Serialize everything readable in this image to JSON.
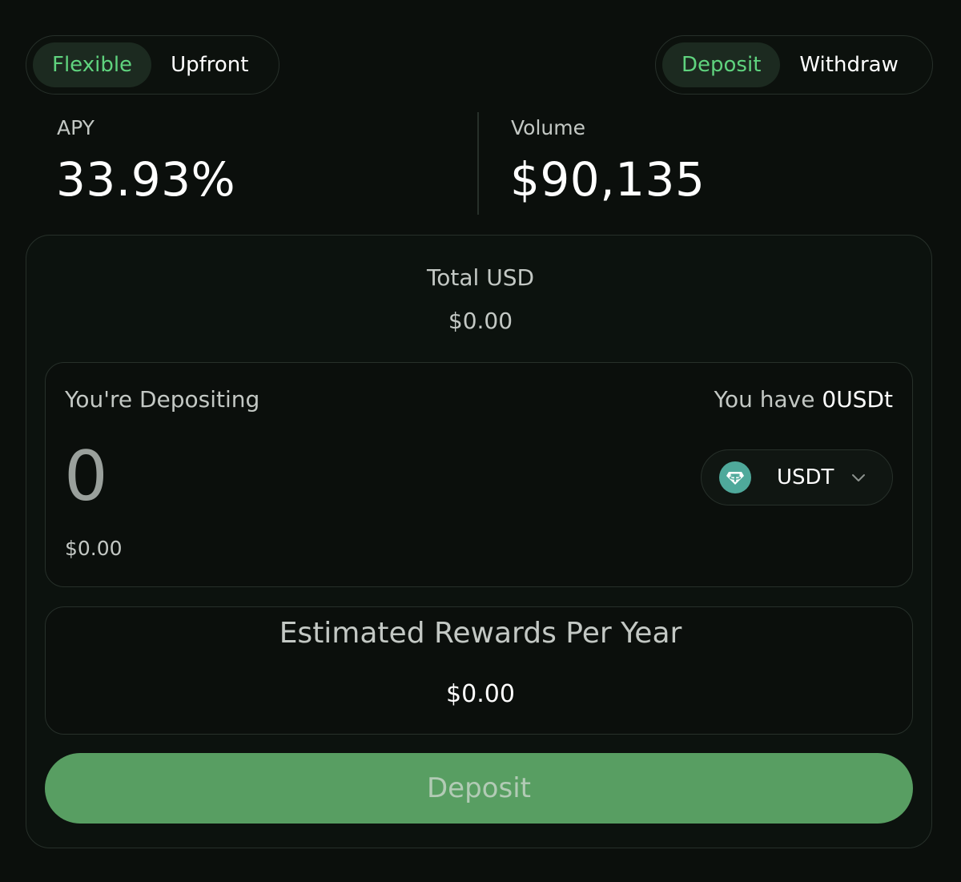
{
  "mode_toggle": {
    "options": [
      "Flexible",
      "Upfront"
    ],
    "selected": "Flexible"
  },
  "action_toggle": {
    "options": [
      "Deposit",
      "Withdraw"
    ],
    "selected": "Deposit"
  },
  "stats": {
    "apy_label": "APY",
    "apy_value": "33.93%",
    "volume_label": "Volume",
    "volume_value": "$90,135"
  },
  "total": {
    "label": "Total USD",
    "value": "$0.00"
  },
  "deposit_panel": {
    "label": "You're Depositing",
    "balance_prefix": "You have",
    "balance_value": "0USDt",
    "amount": "0",
    "amount_usd": "$0.00",
    "token": "USDT",
    "token_icon": "tether-icon"
  },
  "rewards": {
    "label": "Estimated Rewards Per Year",
    "value": "$0.00"
  },
  "submit": {
    "label": "Deposit"
  },
  "colors": {
    "background": "#0b0f0c",
    "accent_green": "#5fd37e",
    "button_green": "#589e62",
    "token_teal": "#4fa99b"
  }
}
